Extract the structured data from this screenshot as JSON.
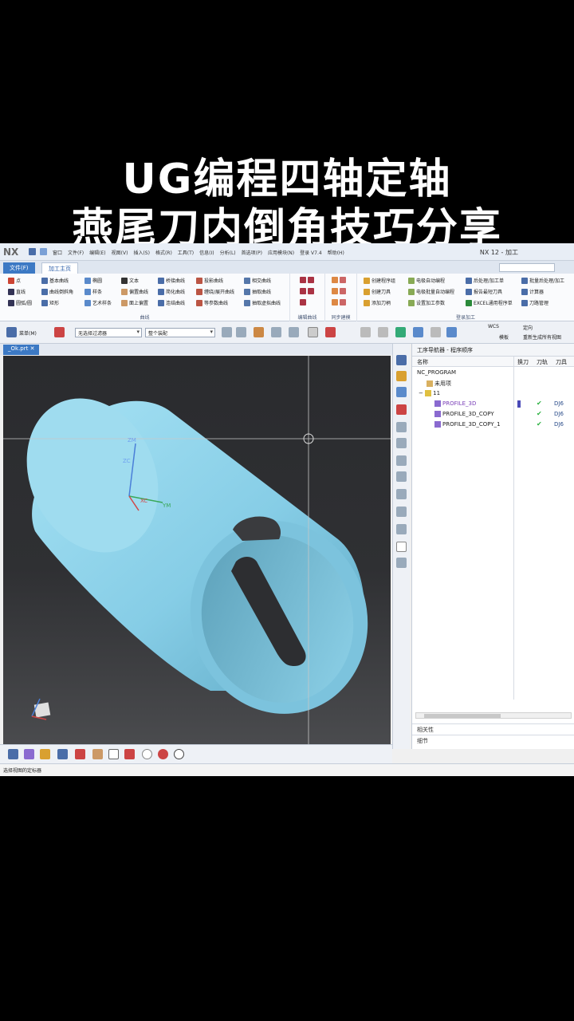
{
  "overlay": {
    "line1": "UG编程四轴定轴",
    "line2": "燕尾刀内倒角技巧分享"
  },
  "titlebar": {
    "logo": "NX",
    "menus": [
      "窗口",
      "文件(F)",
      "编辑(E)",
      "视图(V)",
      "插入(S)",
      "格式(R)",
      "工具(T)",
      "信息(I)",
      "分析(L)",
      "首选项(P)",
      "应用模块(N)",
      "登录 V7.4",
      "帮助(H)"
    ],
    "window_title": "NX 12 - 加工"
  },
  "ribbon_tabs": {
    "file": "文件(F)",
    "home": "加工主页"
  },
  "ribbon": {
    "col1": [
      "点",
      "直线",
      "圆弧/圆"
    ],
    "col2": [
      "基本曲线",
      "曲线倒斜角",
      "矩形"
    ],
    "col3": [
      "椭圆",
      "样条",
      "艺术样条"
    ],
    "col4": [
      "文本",
      "偏置曲线",
      "面上偏置"
    ],
    "col5": [
      "桥接曲线",
      "简化曲线",
      "连结曲线"
    ],
    "col6": [
      "投影曲线",
      "缠绕/展开曲线",
      "等参数曲线"
    ],
    "col7": [
      "相交曲线",
      "抽取曲线",
      "抽取虚拟曲线"
    ],
    "group_curve": "曲线",
    "group_edit": "编辑曲线",
    "group_sync": "同步建模",
    "ops1": [
      "创建程序组",
      "创建刀具",
      "添加刀柄"
    ],
    "ops2": [
      "电极自动编程",
      "电极批量自动编程",
      "设置加工参数"
    ],
    "ops3": [
      "后处理/加工单",
      "报告最短刀具",
      "EXCEL通用程序单"
    ],
    "ops4": [
      "批量后处理/加工",
      "计算器",
      "刀路管理"
    ],
    "group_ops": "登录加工"
  },
  "toolbar2": {
    "menu_label": "菜单(M)",
    "filter_value": "无选择过滤器",
    "assembly_value": "整个装配",
    "wcs": "WCS",
    "orient": "定向",
    "model": "模板",
    "regen": "重新生成所有视图"
  },
  "doc_tab": "_Ok.prt",
  "viewport_labels": {
    "zm": "ZM",
    "zc": "ZC",
    "ym": "YM",
    "xc": "XC"
  },
  "navigator": {
    "title": "工序导航器 - 程序顺序",
    "columns": [
      "名称",
      "换刀",
      "刀轨",
      "刀具"
    ],
    "rows": [
      {
        "name": "NC_PROGRAM",
        "level": 0,
        "kind": "root",
        "tool": ""
      },
      {
        "name": "未用项",
        "level": 1,
        "kind": "folder",
        "tool": ""
      },
      {
        "name": "11",
        "level": 1,
        "kind": "group",
        "tool": ""
      },
      {
        "name": "PROFILE_3D",
        "level": 2,
        "kind": "op",
        "tool": "DJ6",
        "highlight": true
      },
      {
        "name": "PROFILE_3D_COPY",
        "level": 2,
        "kind": "op",
        "tool": "DJ6"
      },
      {
        "name": "PROFILE_3D_COPY_1",
        "level": 2,
        "kind": "op",
        "tool": "DJ6"
      }
    ],
    "check_mark": "✔",
    "section_dependencies": "相关性",
    "section_details": "细节"
  },
  "status": "选择视图的定标器",
  "colors": {
    "accent": "#3c79c4",
    "part": "#8fd3ea",
    "check": "#2bb140"
  }
}
